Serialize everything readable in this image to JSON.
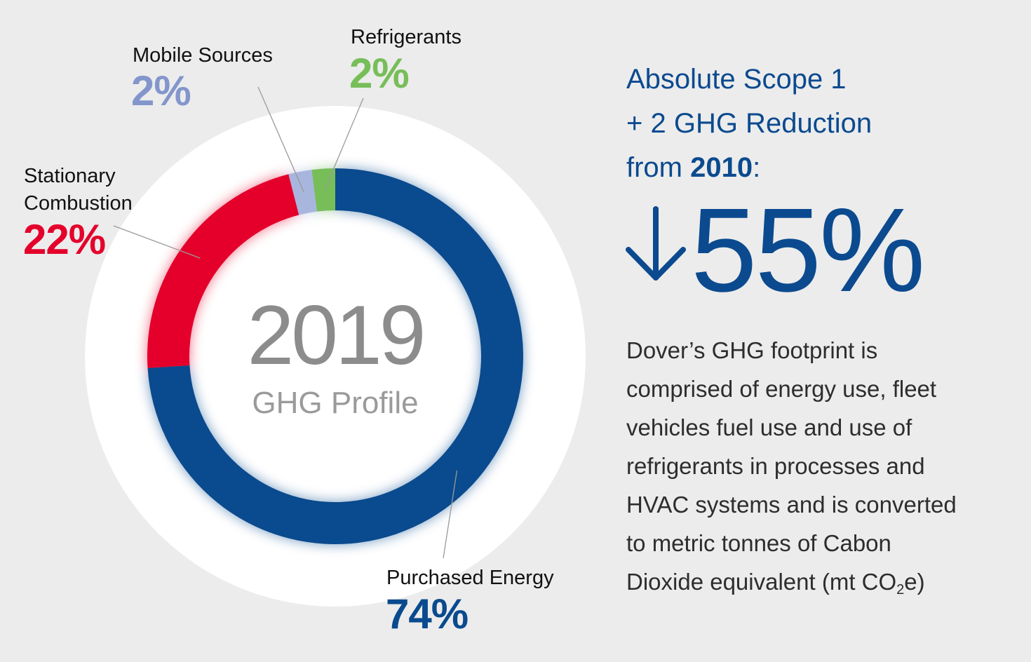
{
  "chart_data": {
    "type": "pie",
    "variant": "donut",
    "categories": [
      "Purchased Energy",
      "Stationary Combustion",
      "Mobile Sources",
      "Refrigerants"
    ],
    "values": [
      74,
      22,
      2,
      2
    ],
    "value_labels": [
      "74%",
      "22%",
      "2%",
      "2%"
    ],
    "colors": [
      "#0a4a8e",
      "#e4002b",
      "#a8b6de",
      "#77be59"
    ],
    "center_title": "2019",
    "center_subtitle": "GHG Profile",
    "legend": "none",
    "grid": false
  },
  "headline": {
    "line1": "Absolute Scope 1",
    "line2": "+ 2 GHG Reduction",
    "line3_prefix": "from ",
    "line3_bold": "2010",
    "line3_suffix": ":"
  },
  "metric": {
    "arrow_icon": "down-arrow-icon",
    "value": "55%"
  },
  "description": {
    "lines": [
      "Dover’s GHG footprint is",
      "comprised of energy use, fleet",
      "vehicles fuel use and use of",
      "refrigerants in processes and",
      "HVAC systems and is converted",
      "to metric tonnes of Cabon"
    ],
    "last_prefix": "Dioxide equivalent (mt CO",
    "last_sub": "2",
    "last_suffix": "e)"
  }
}
